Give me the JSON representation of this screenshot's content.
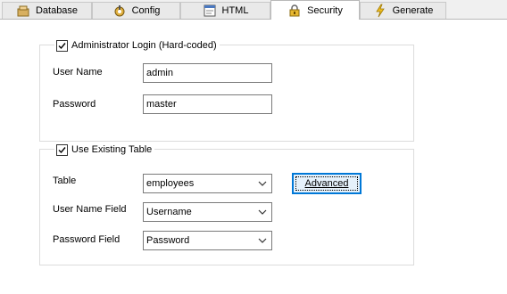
{
  "tabs": [
    {
      "label": "Database",
      "icon": "database-icon"
    },
    {
      "label": "Config",
      "icon": "config-icon"
    },
    {
      "label": "HTML",
      "icon": "html-icon"
    },
    {
      "label": "Security",
      "icon": "lock-icon",
      "active": true
    },
    {
      "label": "Generate",
      "icon": "lightning-icon"
    }
  ],
  "admin_login": {
    "legend": "Administrator Login (Hard-coded)",
    "checked": true,
    "user_name_label": "User Name",
    "user_name_value": "admin",
    "password_label": "Password",
    "password_value": "master"
  },
  "existing_table": {
    "legend": "Use Existing Table",
    "checked": true,
    "table_label": "Table",
    "table_value": "employees",
    "advanced_button": "Advanced",
    "user_name_field_label": "User Name Field",
    "user_name_field_value": "Username",
    "password_field_label": "Password Field",
    "password_field_value": "Password"
  },
  "colors": {
    "focus_border": "#0078d7",
    "button_fill": "#e5f1fb",
    "panel_bg": "#ffffff",
    "window_bg": "#f0f0f0"
  }
}
